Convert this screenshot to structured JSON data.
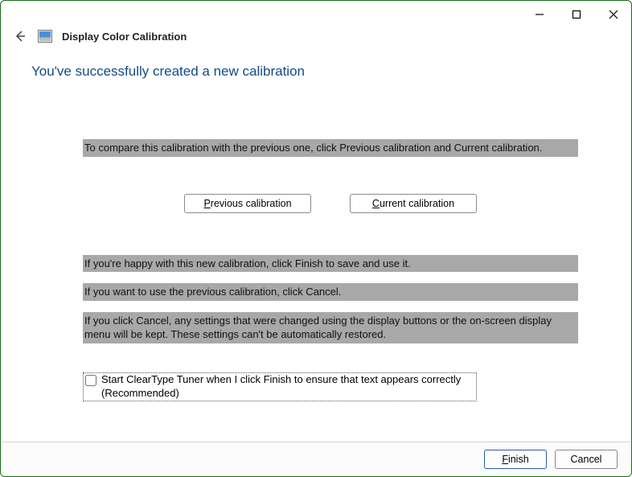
{
  "window": {
    "app_title": "Display Color Calibration",
    "heading": "You've successfully created a new calibration"
  },
  "body": {
    "compare_text": "To compare this calibration with the previous one, click Previous calibration and Current calibration.",
    "prev_btn_pre": "P",
    "prev_btn_rest": "revious calibration",
    "curr_btn_pre": "C",
    "curr_btn_rest": "urrent calibration",
    "happy_text": "If you're happy with this new calibration, click Finish to save and use it.",
    "use_prev_text": "If you want to use the previous calibration, click Cancel.",
    "cancel_note_text": "If you click Cancel, any settings that were changed using the display buttons or the on-screen display menu will be kept. These settings can't be automatically restored.",
    "cleartype_label": "Start ClearType Tuner when I click Finish to ensure that text appears correctly (Recommended)"
  },
  "footer": {
    "finish_pre": "F",
    "finish_rest": "inish",
    "cancel": "Cancel"
  }
}
